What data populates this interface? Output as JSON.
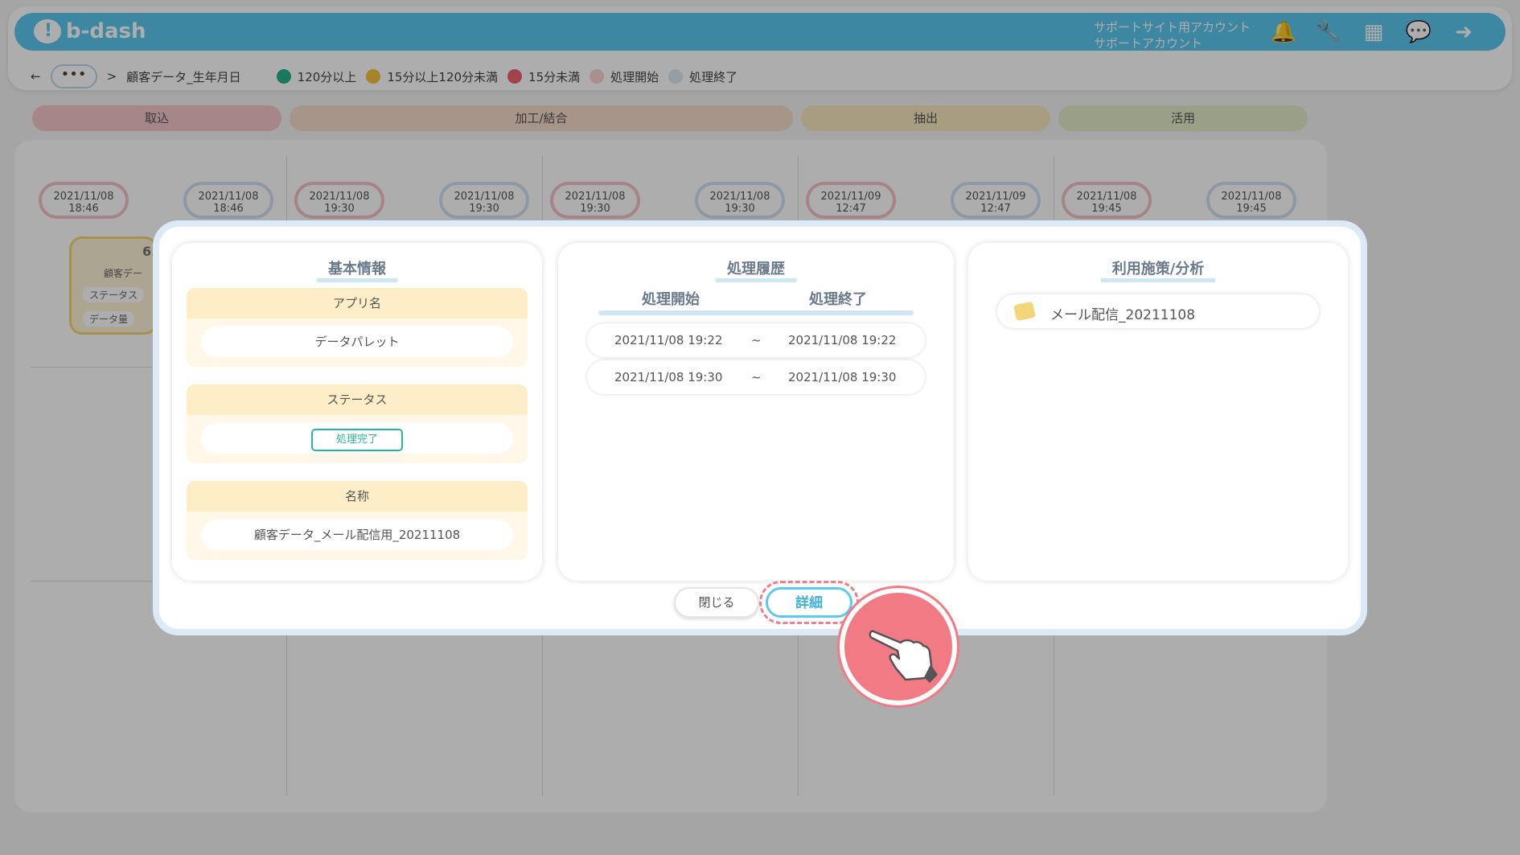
{
  "header": {
    "logo_text": "b-dash",
    "account_line1": "サポートサイト用アカウント",
    "account_line2": "サポートアカウント",
    "icons": [
      "bell-icon",
      "wrench-icon",
      "grid-icon",
      "chat-icon",
      "logout-icon"
    ]
  },
  "breadcrumb": {
    "back": "←",
    "more": "•••",
    "separator": ">",
    "current": "顧客データ_生年月日"
  },
  "legend": [
    {
      "label": "120分以上",
      "color": "#27b28a"
    },
    {
      "label": "15分以上120分未満",
      "color": "#f0c33c"
    },
    {
      "label": "15分未満",
      "color": "#ec6472"
    },
    {
      "label": "処理開始",
      "color": "#f8d3d5"
    },
    {
      "label": "処理終了",
      "color": "#dde9f4"
    }
  ],
  "phases": [
    {
      "label": "取込",
      "color": "#f6c6cc"
    },
    {
      "label": "加工/結合",
      "color": "#f6dccb"
    },
    {
      "label": "抽出",
      "color": "#f8e7bf"
    },
    {
      "label": "活用",
      "color": "#e3ecc9"
    }
  ],
  "timeline": [
    {
      "date": "2021/11/08",
      "time": "18:46",
      "kind": "start"
    },
    {
      "date": "2021/11/08",
      "time": "18:46",
      "kind": "end"
    },
    {
      "date": "2021/11/08",
      "time": "19:30",
      "kind": "start"
    },
    {
      "date": "2021/11/08",
      "time": "19:30",
      "kind": "end"
    },
    {
      "date": "2021/11/08",
      "time": "19:30",
      "kind": "start"
    },
    {
      "date": "2021/11/08",
      "time": "19:30",
      "kind": "end"
    },
    {
      "date": "2021/11/09",
      "time": "12:47",
      "kind": "start"
    },
    {
      "date": "2021/11/09",
      "time": "12:47",
      "kind": "end"
    },
    {
      "date": "2021/11/08",
      "time": "19:45",
      "kind": "start"
    },
    {
      "date": "2021/11/08",
      "time": "19:45",
      "kind": "end"
    }
  ],
  "card_peek": {
    "number": "6.",
    "title": "顧客デー",
    "status_label": "ステータス",
    "volume_label": "データ量"
  },
  "modal": {
    "basic": {
      "title": "基本情報",
      "app_label": "アプリ名",
      "app_value": "データパレット",
      "status_label": "ステータス",
      "status_value": "処理完了",
      "name_label": "名称",
      "name_value": "顧客データ_メール配信用_20211108"
    },
    "history": {
      "title": "処理履歴",
      "start_head": "処理開始",
      "end_head": "処理終了",
      "rows": [
        {
          "start": "2021/11/08 19:22",
          "sep": "~",
          "end": "2021/11/08 19:22"
        },
        {
          "start": "2021/11/08 19:30",
          "sep": "~",
          "end": "2021/11/08 19:30"
        }
      ]
    },
    "usage": {
      "title": "利用施策/分析",
      "items": [
        {
          "label": "メール配信_20211108",
          "icon": "mail-delivery-icon"
        }
      ]
    },
    "buttons": {
      "close": "閉じる",
      "detail": "詳細"
    }
  },
  "colors": {
    "brand": "#5bc8ef",
    "status_done": "#29b69a",
    "pointer": "#f27a85"
  }
}
